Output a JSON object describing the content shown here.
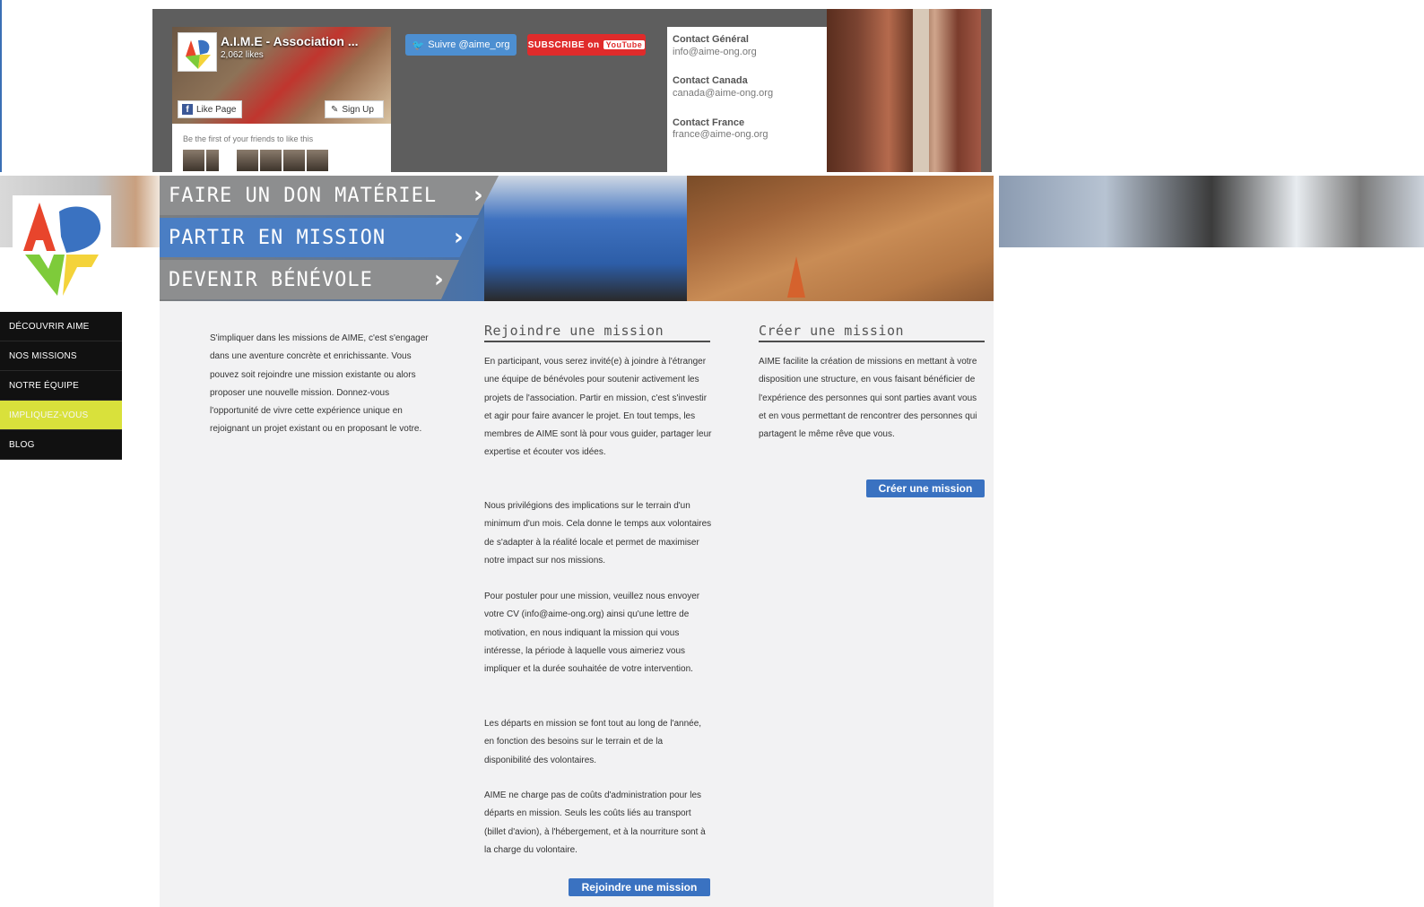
{
  "facebook": {
    "page_name": "A.I.M.E - Association ...",
    "likes": "2,062 likes",
    "like_label": "Like Page",
    "sign_label": "Sign Up",
    "friends_text": "Be the first of your friends to like this"
  },
  "social": {
    "twitter_label": "Suivre @aime_org",
    "youtube_label": "SUBSCRIBE on",
    "youtube_badge": "YouTube"
  },
  "contacts": [
    {
      "title": "Contact Général",
      "email": "info@aime-ong.org"
    },
    {
      "title": "Contact Canada",
      "email": "canada@aime-ong.org"
    },
    {
      "title": "Contact France",
      "email": "france@aime-ong.org"
    }
  ],
  "banner_nav": [
    {
      "label": "FAIRE UN DON MATÉRIEL"
    },
    {
      "label": "PARTIR EN MISSION"
    },
    {
      "label": "DEVENIR BÉNÉVOLE"
    }
  ],
  "sidebar": {
    "items": [
      {
        "label": "DÉCOUVRIR AIME"
      },
      {
        "label": "NOS MISSIONS"
      },
      {
        "label": "NOTRE ÉQUIPE"
      },
      {
        "label": "IMPLIQUEZ-VOUS"
      },
      {
        "label": "BLOG"
      }
    ]
  },
  "intro": "S'impliquer dans les missions de AIME, c'est s'engager dans une aventure concrète et enrichissante. Vous pouvez soit rejoindre une mission existante ou alors proposer une nouvelle mission. Donnez-vous l'opportunité de vivre cette expérience unique en rejoignant un projet existant ou en proposant le votre.",
  "join": {
    "title": "Rejoindre une mission",
    "paragraphs": [
      "En participant, vous serez invité(e) à joindre à l'étranger une équipe de bénévoles pour soutenir activement les projets de l'association. Partir en mission, c'est s'investir et agir pour faire avancer le projet. En tout temps, les membres de AIME sont là pour vous guider, partager leur expertise et écouter vos idées.",
      "Nous privilégions des implications sur le terrain d'un minimum d'un mois. Cela donne le temps aux volontaires de s'adapter à la réalité locale et permet de maximiser notre impact sur nos missions.",
      "Pour postuler pour une mission, veuillez nous envoyer votre CV (info@aime-ong.org) ainsi qu'une lettre de motivation, en nous indiquant la mission qui vous intéresse, la période à laquelle vous aimeriez vous impliquer et la durée souhaitée de votre intervention.",
      "Les départs en mission se font tout au long de l'année, en fonction des besoins sur le terrain et de la disponibilité des volontaires.",
      "AIME ne charge pas de coûts d'administration pour les départs en mission. Seuls les coûts liés au transport (billet d'avion), à l'hébergement, et à la nourriture sont à la charge du volontaire."
    ],
    "button": "Rejoindre une mission"
  },
  "create": {
    "title": "Créer une mission",
    "paragraph": "AIME facilite la création de missions en mettant à votre disposition une structure, en vous faisant bénéficier de l'expérience des personnes qui sont parties avant vous et en vous permettant de rencontrer des personnes qui partagent le même rêve que vous.",
    "button": "Créer une mission"
  },
  "colors": {
    "accent_blue": "#3a72c1",
    "active_menu": "#d9e13b",
    "menu_bg": "#111111",
    "content_bg": "#f2f2f3"
  }
}
